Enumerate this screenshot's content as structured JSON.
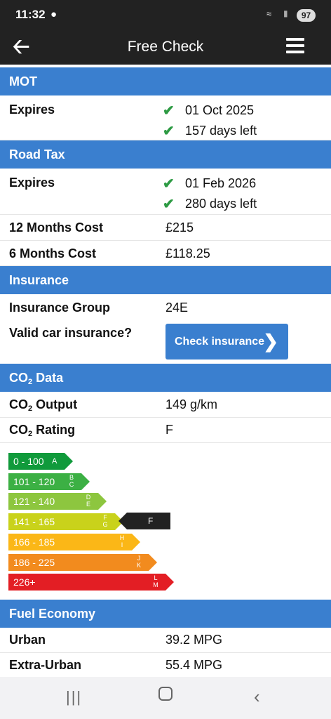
{
  "status": {
    "time": "11:32",
    "battery": "97"
  },
  "appbar": {
    "title": "Free Check"
  },
  "mot": {
    "header": "MOT",
    "expires_label": "Expires",
    "expires_date": "01 Oct 2025",
    "days_left": "157 days left"
  },
  "road_tax": {
    "header": "Road Tax",
    "expires_label": "Expires",
    "expires_date": "01 Feb 2026",
    "days_left": "280 days left",
    "cost12_label": "12 Months Cost",
    "cost12_value": "£215",
    "cost6_label": "6 Months Cost",
    "cost6_value": "£118.25"
  },
  "insurance": {
    "header": "Insurance",
    "group_label": "Insurance Group",
    "group_value": "24E",
    "valid_label": "Valid car insurance?",
    "check_button": "Check insurance"
  },
  "co2": {
    "header_prefix": "CO",
    "header_sub": "2",
    "header_suffix": " Data",
    "output_label_prefix": "CO",
    "output_label_suffix": " Output",
    "output_value": "149 g/km",
    "rating_label_suffix": " Rating",
    "rating_value": "F",
    "bands": [
      {
        "range": "0 - 100",
        "letters": "A",
        "color": "#109a3b"
      },
      {
        "range": "101 - 120",
        "letters": "B C",
        "color": "#3cb044"
      },
      {
        "range": "121 - 140",
        "letters": "D E",
        "color": "#8dc63f"
      },
      {
        "range": "141 - 165",
        "letters": "F G",
        "color": "#c9d21b"
      },
      {
        "range": "166 - 185",
        "letters": "H I",
        "color": "#fbb717"
      },
      {
        "range": "186 - 225",
        "letters": "J K",
        "color": "#f28b1e"
      },
      {
        "range": "226+",
        "letters": "L M",
        "color": "#e31e24"
      }
    ],
    "marker_label": "F"
  },
  "fuel": {
    "header": "Fuel Economy",
    "urban_label": "Urban",
    "urban_value": "39.2 MPG",
    "extra_label": "Extra-Urban",
    "extra_value": "55.4 MPG"
  }
}
